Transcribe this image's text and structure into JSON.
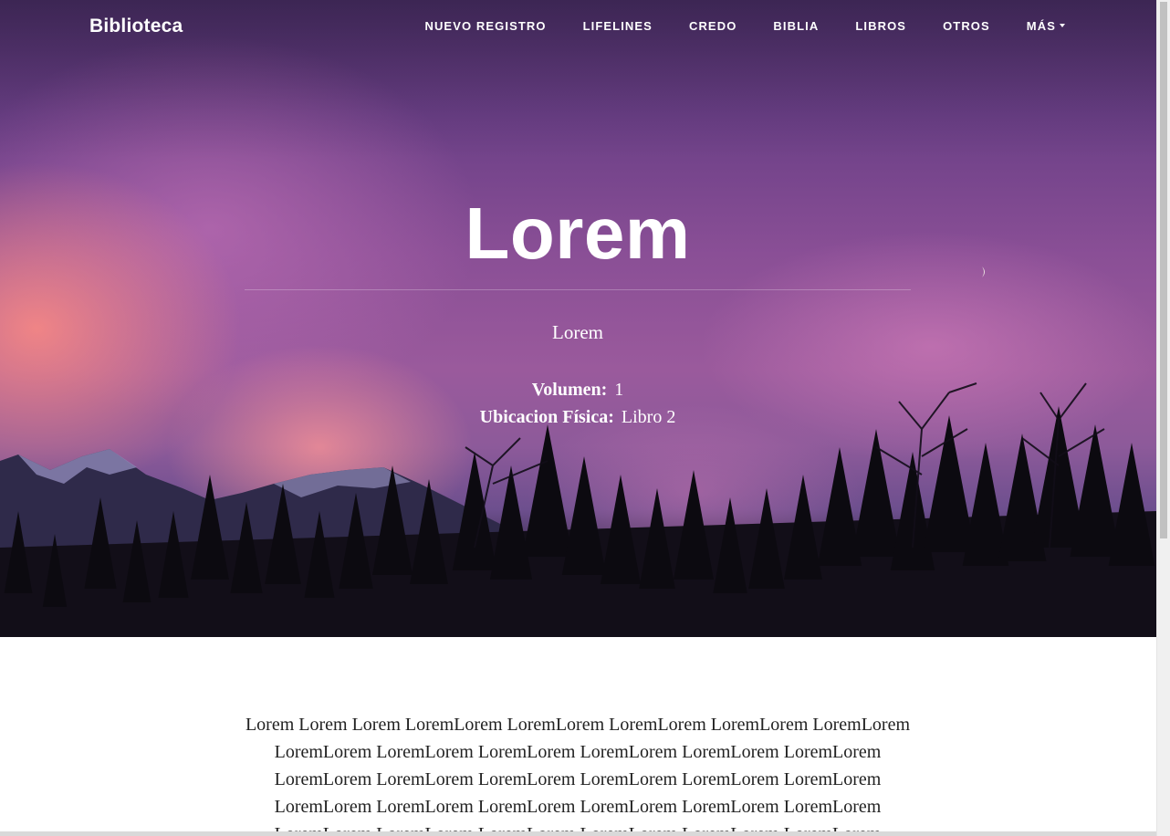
{
  "nav": {
    "brand": "Biblioteca",
    "items": [
      {
        "label": "Nuevo Registro"
      },
      {
        "label": "Lifelines"
      },
      {
        "label": "Credo"
      },
      {
        "label": "Biblia"
      },
      {
        "label": "Libros"
      },
      {
        "label": "Otros"
      },
      {
        "label": "Más",
        "dropdown": true
      }
    ]
  },
  "hero": {
    "title": "Lorem",
    "subtitle": "Lorem",
    "volume_label": "Volumen:",
    "volume_value": "1",
    "location_label": "Ubicacion Física:",
    "location_value": "Libro 2"
  },
  "content": {
    "text": "Lorem Lorem Lorem LoremLorem LoremLorem LoremLorem LoremLorem LoremLorem LoremLorem LoremLorem LoremLorem LoremLorem LoremLorem LoremLorem LoremLorem LoremLorem LoremLorem LoremLorem LoremLorem LoremLorem LoremLorem LoremLorem LoremLorem LoremLorem LoremLorem LoremLorem LoremLorem LoremLorem LoremLorem LoremLorem LoremLorem LoremLorem LoremLorem LoremLorem LoremLorem LoremLorem"
  },
  "colors": {
    "text_on_hero": "#ffffff",
    "body_text": "#222222",
    "sky_purple": "#8a4f96"
  }
}
